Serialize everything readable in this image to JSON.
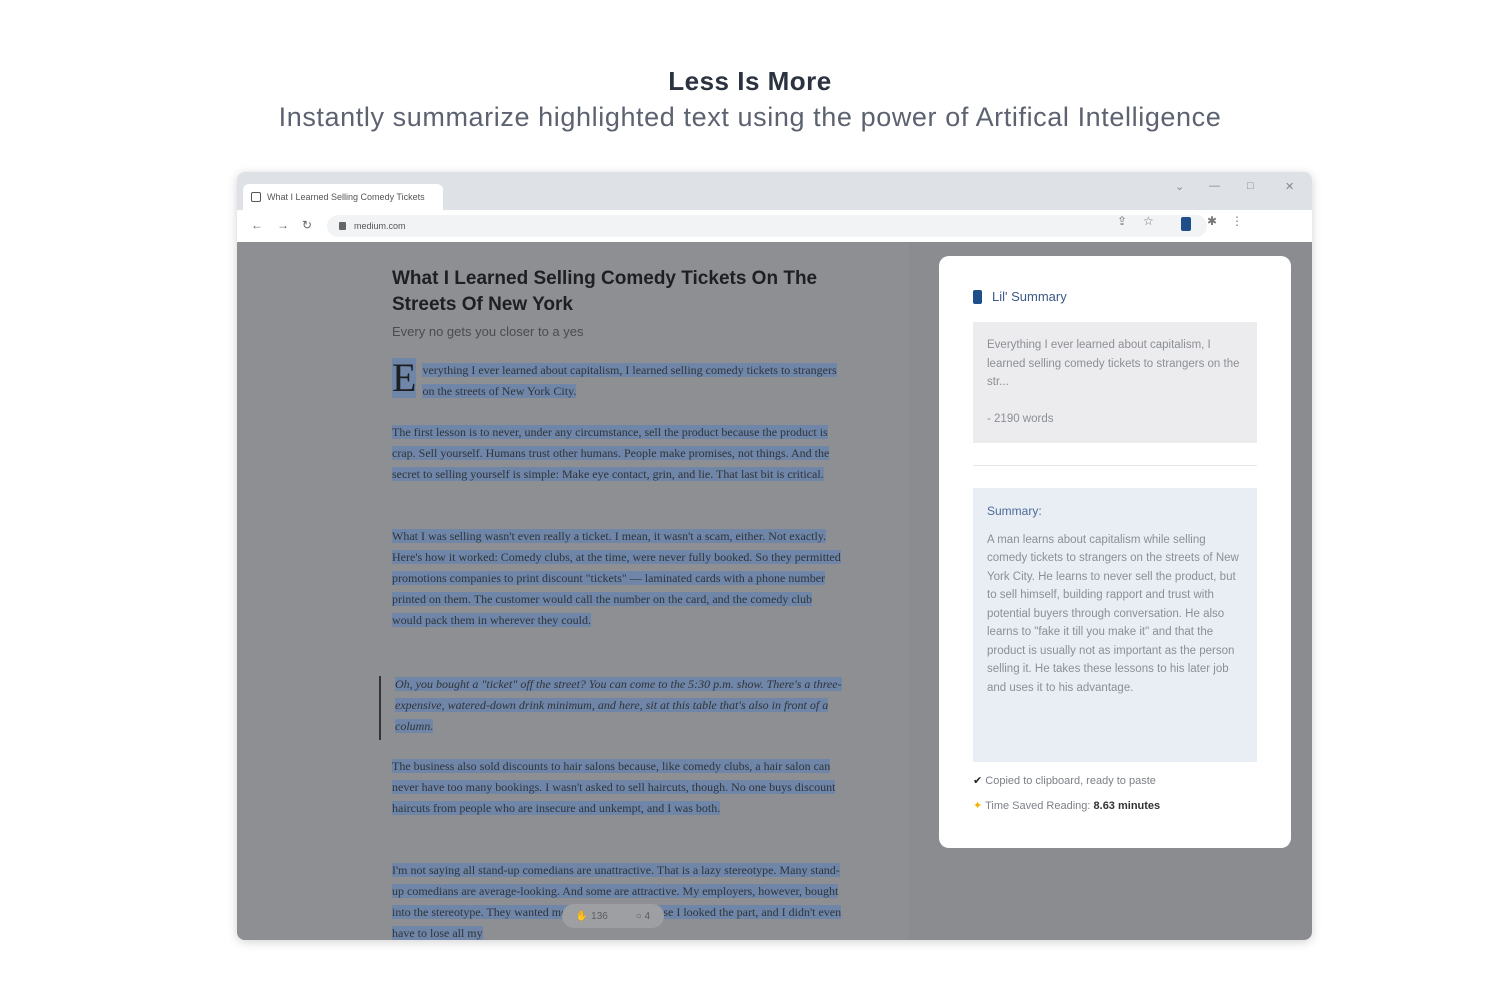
{
  "hero": {
    "title": "Less Is More",
    "subtitle": "Instantly summarize highlighted text using the power of Artifical Intelligence"
  },
  "browser": {
    "tab_title": "What I Learned Selling Comedy Tickets",
    "url": "medium.com",
    "window_controls": [
      "⌄",
      "—",
      "□",
      "✕"
    ]
  },
  "article": {
    "title": "What I Learned Selling Comedy Tickets On The Streets Of New York",
    "subtitle": "Every no gets you closer to a yes",
    "dropcap": "E",
    "p1": "verything I ever learned about capitalism, I learned selling comedy tickets to strangers on the streets of New York City.",
    "p2": "The first lesson is to never, under any circumstance, sell the product because the product is crap. Sell yourself. Humans trust other humans. People make promises, not things. And the secret to selling yourself is simple: Make eye contact, grin, and lie. That last bit is critical.",
    "p3": "What I was selling wasn't even really a ticket. I mean, it wasn't a scam, either. Not exactly. Here's how it worked: Comedy clubs, at the time, were never fully booked. So they permitted promotions companies to print discount \"tickets\" — laminated cards with a phone number printed on them. The customer would call the number on the card, and the comedy club would pack them in wherever they could.",
    "quote": "Oh, you bought a \"ticket\" off the street? You can come to the 5:30 p.m. show. There's a three-expensive, watered-down drink minimum, and here, sit at this table that's also in front of a column.",
    "p4": "The business also sold discounts to hair salons because, like comedy clubs, a hair salon can never have too many bookings. I wasn't asked to sell haircuts, though. No one buys discount haircuts from people who are insecure and unkempt, and I was both.",
    "p5": "I'm not saying all stand-up comedians are unattractive. That is a lazy stereotype. Many stand-up comedians are average-looking. And some are attractive. My employers, however, bought into the stereotype. They wanted me to play a part because I looked the part, and I didn't even have to lose all my",
    "clap_count": "136",
    "comment_count": "4"
  },
  "summary_panel": {
    "name": "Lil' Summary",
    "original_text": "Everything I ever learned about capitalism, I learned selling comedy tickets to strangers on the str...",
    "word_count": "- 2190 words",
    "summary_label": "Summary:",
    "summary_text": "A man learns about capitalism while selling comedy tickets to strangers on the streets of New York City. He learns to never sell the product, but to sell himself, building rapport and trust with potential buyers through conversation. He also learns to \"fake it till you make it\" and that the product is usually not as important as the person selling it. He takes these lessons to his later job and uses it to his advantage.",
    "copied_text": "Copied to clipboard, ready to paste",
    "time_saved_label": "Time Saved Reading:",
    "time_saved_value": "8.63 minutes"
  }
}
